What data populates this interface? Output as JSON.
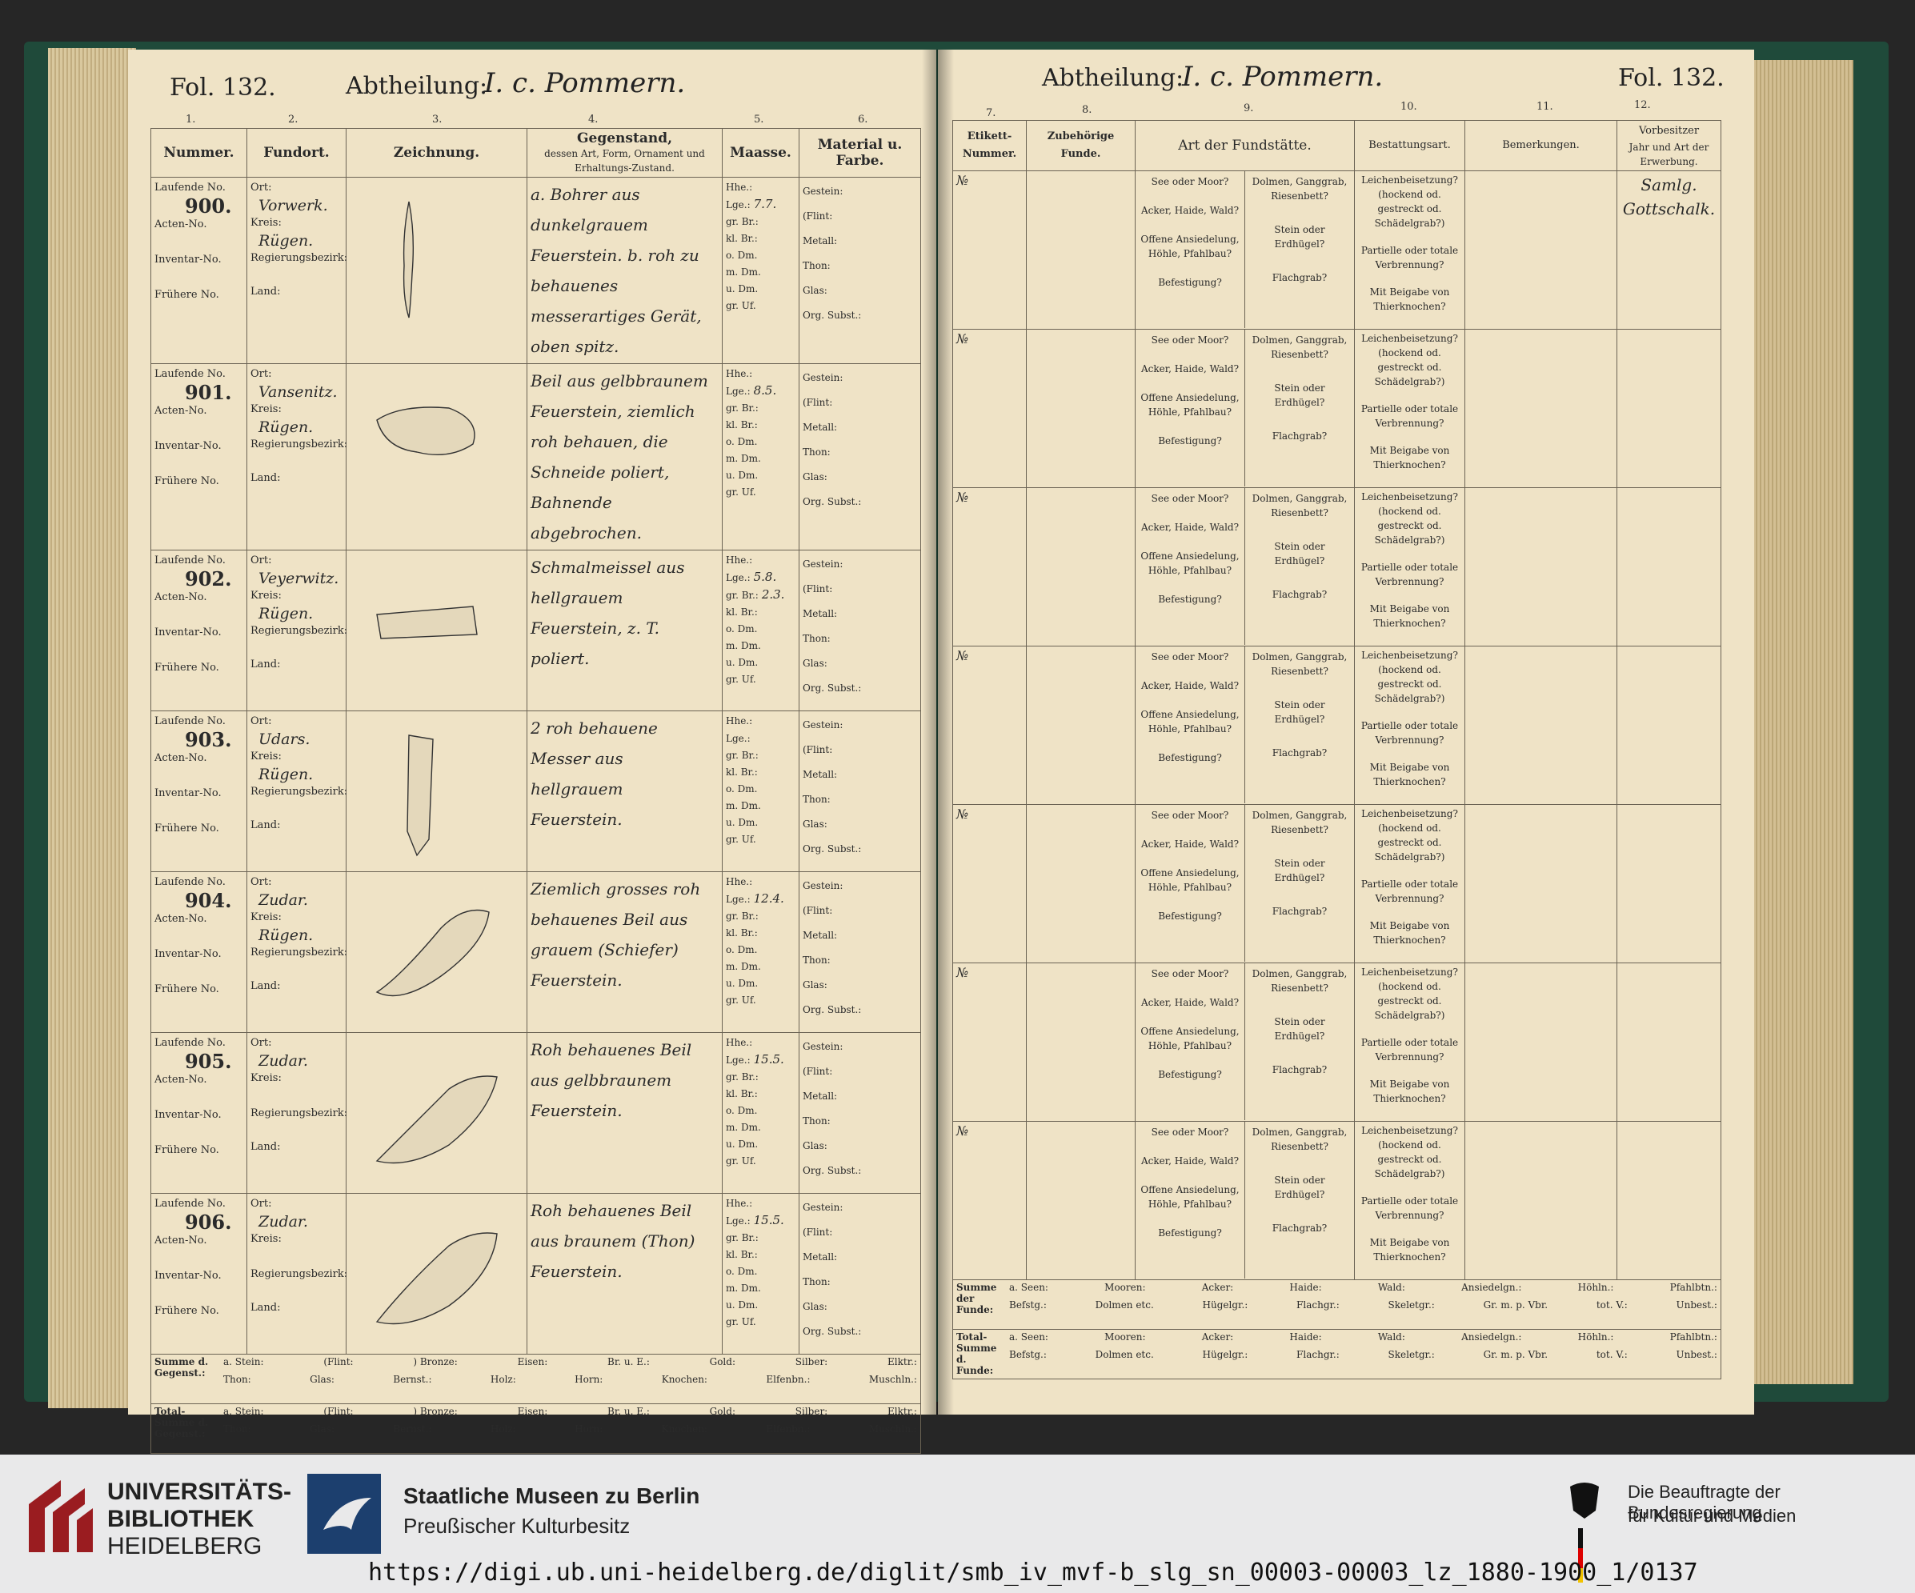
{
  "left_page": {
    "folio": "Fol. 132.",
    "abtheilung_label": "Abtheilung:",
    "abtheilung_value": "I. c. Pommern.",
    "col_numbers": [
      "1.",
      "2.",
      "3.",
      "4.",
      "5.",
      "6."
    ],
    "headers": {
      "nummer": "Nummer.",
      "fundort": "Fundort.",
      "zeichnung": "Zeichnung.",
      "gegenstand": "Gegenstand,",
      "gegenstand_sub": "dessen Art, Form, Ornament und Erhaltungs-Zustand.",
      "maasse": "Maasse.",
      "material": "Material u. Farbe."
    },
    "labels": {
      "laufende": "Laufende No.",
      "acten": "Acten-No.",
      "inventar": "Inventar-No.",
      "fruehere": "Frühere No.",
      "ort": "Ort:",
      "kreis": "Kreis:",
      "regbez": "Regierungsbezirk:",
      "land": "Land:",
      "maasse_list": [
        "Hhe.:",
        "Lge.:",
        "gr. Br.:",
        "kl. Br.:",
        "o. Dm.",
        "m. Dm.",
        "u. Dm.",
        "gr. Uf."
      ],
      "material_list": [
        "Gestein:",
        "(Flint:",
        "Metall:",
        "Thon:",
        "Glas:",
        "Org. Subst.:"
      ]
    },
    "rows": [
      {
        "num": "900.",
        "ort": "Vorwerk.",
        "kreis": "Rügen.",
        "desc": "a. Bohrer aus dunkelgrauem Feuerstein. b. roh zu behauenes messerartiges Gerät, oben spitz.",
        "lge": "7.7."
      },
      {
        "num": "901.",
        "ort": "Vansenitz.",
        "kreis": "Rügen.",
        "desc": "Beil aus gelbbraunem Feuerstein, ziemlich roh behauen, die Schneide poliert, Bahnende abgebrochen.",
        "lge": "8.5."
      },
      {
        "num": "902.",
        "ort": "Veyerwitz.",
        "kreis": "Rügen.",
        "desc": "Schmalmeissel aus hellgrauem Feuerstein, z. T. poliert.",
        "lge": "5.8.",
        "gr_br": "2.3."
      },
      {
        "num": "903.",
        "ort": "Udars.",
        "kreis": "Rügen.",
        "desc": "2 roh behauene Messer aus hellgrauem Feuerstein.",
        "lge": ""
      },
      {
        "num": "904.",
        "ort": "Zudar.",
        "kreis": "Rügen.",
        "desc": "Ziemlich grosses roh behauenes Beil aus grauem (Schiefer) Feuerstein.",
        "lge": "12.4."
      },
      {
        "num": "905.",
        "ort": "Zudar.",
        "kreis": "",
        "desc": "Roh behauenes Beil aus gelbbraunem Feuerstein.",
        "lge": "15.5."
      },
      {
        "num": "906.",
        "ort": "Zudar.",
        "kreis": "",
        "desc": "Roh behauenes Beil aus braunem (Thon) Feuerstein.",
        "lge": "15.5."
      }
    ],
    "summe": {
      "label": "Summe d. Gegenst.:",
      "row1": [
        "a. Stein:",
        "(Flint:",
        ") Bronze:",
        "Eisen:",
        "Br. u. E.:",
        "Gold:",
        "Silber:",
        "Elktr.:"
      ],
      "row2": [
        "Thon:",
        "Glas:",
        "Bernst.:",
        "Holz:",
        "Horn:",
        "Knochen:",
        "Elfenbn.:",
        "Muschln.:"
      ]
    },
    "total": {
      "label": "Total-Summe d. Gegenst.:"
    }
  },
  "right_page": {
    "folio": "Fol. 132.",
    "abtheilung_label": "Abtheilung:",
    "abtheilung_value": "I. c. Pommern.",
    "col_numbers": [
      "7.",
      "8.",
      "9.",
      "10.",
      "11.",
      "12."
    ],
    "headers": {
      "etikett": "Etikett-Nummer.",
      "zubehoerige": "Zubehörige Funde.",
      "fundstaette": "Art der Fundstätte.",
      "bestattung": "Bestattungsart.",
      "bemerkungen": "Bemerkungen.",
      "vorbesitzer": "Vorbesitzer",
      "vorbesitzer_sub": "Jahr und Art der Erwerbung."
    },
    "etikett_mark": "№",
    "fund_a": [
      "See oder Moor?",
      "Acker, Haide, Wald?",
      "Offene Ansiedelung, Höhle, Pfahlbau?",
      "Befestigung?"
    ],
    "fund_b": [
      "Dolmen, Ganggrab, Riesenbett?",
      "Stein oder Erdhügel?",
      "Flachgrab?"
    ],
    "bestattung_list": [
      "Leichenbeisetzung? (hockend od. gestreckt od. Schädelgrab?)",
      "Partielle oder totale Verbrennung?",
      "Mit Beigabe von Thierknochen?"
    ],
    "vorbesitzer_value": "Samlg. Gottschalk.",
    "summe": {
      "label": "Summe der Funde:",
      "row1": [
        "a. Seen:",
        "Mooren:",
        "Acker:",
        "Haide:",
        "Wald:",
        "Ansiedelgn.:",
        "Höhln.:",
        "Pfahlbtn.:"
      ],
      "row2": [
        "Befstg.:",
        "Dolmen etc.",
        "Hügelgr.:",
        "Flachgr.:",
        "Skeletgr.:",
        "Gr. m. p. Vbr.",
        "tot. V.:",
        "Unbest.:"
      ]
    },
    "total": {
      "label": "Total-Summe d. Funde:"
    }
  },
  "footer": {
    "ub_line1": "UNIVERSITÄTS-",
    "ub_line2": "BIBLIOTHEK",
    "ub_line3": "HEIDELBERG",
    "smb_line1": "Staatliche Museen zu Berlin",
    "smb_line2": "Preußischer Kulturbesitz",
    "bkm_line1": "Die Beauftragte der Bundesregierung",
    "bkm_line2": "für Kultur und Medien",
    "url": "https://digi.ub.uni-heidelberg.de/diglit/smb_iv_mvf-b_slg_sn_00003-00003_lz_1880-1900_1/0137"
  }
}
